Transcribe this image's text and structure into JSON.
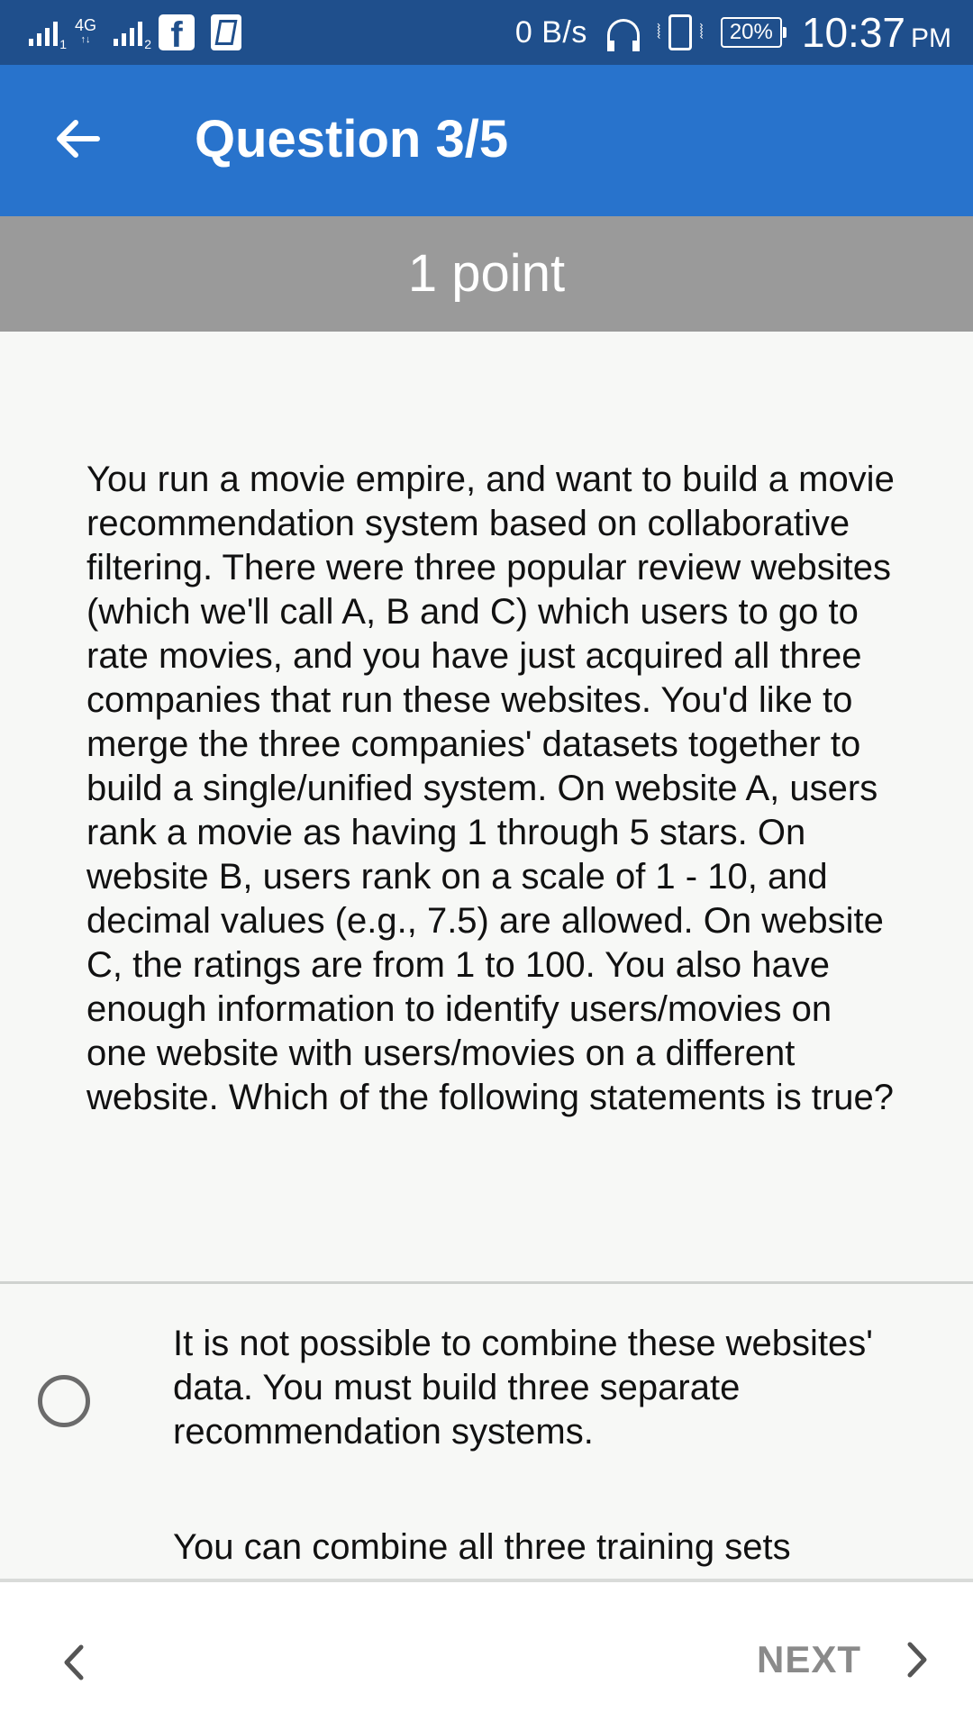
{
  "status_bar": {
    "sim1": "1",
    "network": "4G",
    "sim2": "2",
    "speed": "0 B/s",
    "battery": "20%",
    "time": "10:37",
    "ampm": "PM"
  },
  "header": {
    "title": "Question 3/5"
  },
  "points": "1 point",
  "question": "You run a movie empire, and want to build a movie recommendation system based on collaborative filtering. There were three popular review websites (which we'll call A, B and C) which users to go to rate movies, and you have just acquired all three companies that run these websites. You'd like to merge the three companies' datasets together to build a single/unified system. On website A, users rank a movie as having 1 through 5 stars. On website B, users rank on a scale of 1 - 10, and decimal values (e.g., 7.5) are allowed. On website C, the ratings are from 1 to 100. You also have enough information to identify users/movies on one website with users/movies on a different website. Which of the following statements is true?",
  "options": [
    {
      "text": "It is not possible to combine these websites' data. You must build three separate recommendation systems."
    },
    {
      "text": "You can combine all three training sets"
    }
  ],
  "nav": {
    "next_label": "NEXT"
  },
  "colors": {
    "status_bar": "#1f4f8c",
    "app_bar": "#2873cc",
    "points_bar": "#9a9a9a",
    "background": "#f7f8f6"
  },
  "icons": {
    "back": "arrow-left-icon",
    "prev": "chevron-left-icon",
    "next": "chevron-right-icon",
    "radio": "radio-unchecked-icon"
  }
}
